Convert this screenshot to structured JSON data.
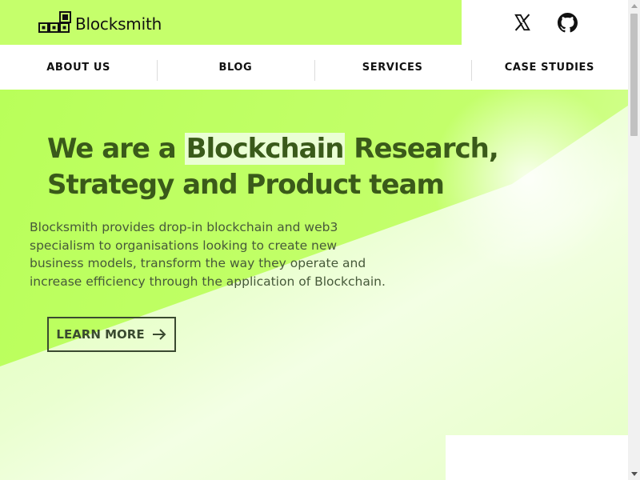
{
  "brand": {
    "name": "Blocksmith",
    "accent": "#c5ff6b"
  },
  "social": [
    {
      "name": "x-icon",
      "label": "X"
    },
    {
      "name": "github-icon",
      "label": "GitHub"
    }
  ],
  "nav": {
    "items": [
      {
        "label": "ABOUT US"
      },
      {
        "label": "BLOG"
      },
      {
        "label": "SERVICES"
      },
      {
        "label": "CASE STUDIES"
      }
    ]
  },
  "hero": {
    "headline_pre": "We are a ",
    "headline_highlight": "Blockchain",
    "headline_post": " Research, Strategy and Product team",
    "description": "Blocksmith provides drop-in blockchain and web3 specialism to organisations looking to create new business models, transform the way they operate and increase efficiency through the application of Blockchain.",
    "cta_label": "LEARN MORE",
    "colors": {
      "green": "#bfff62",
      "headline": "#3a5a1a"
    }
  }
}
